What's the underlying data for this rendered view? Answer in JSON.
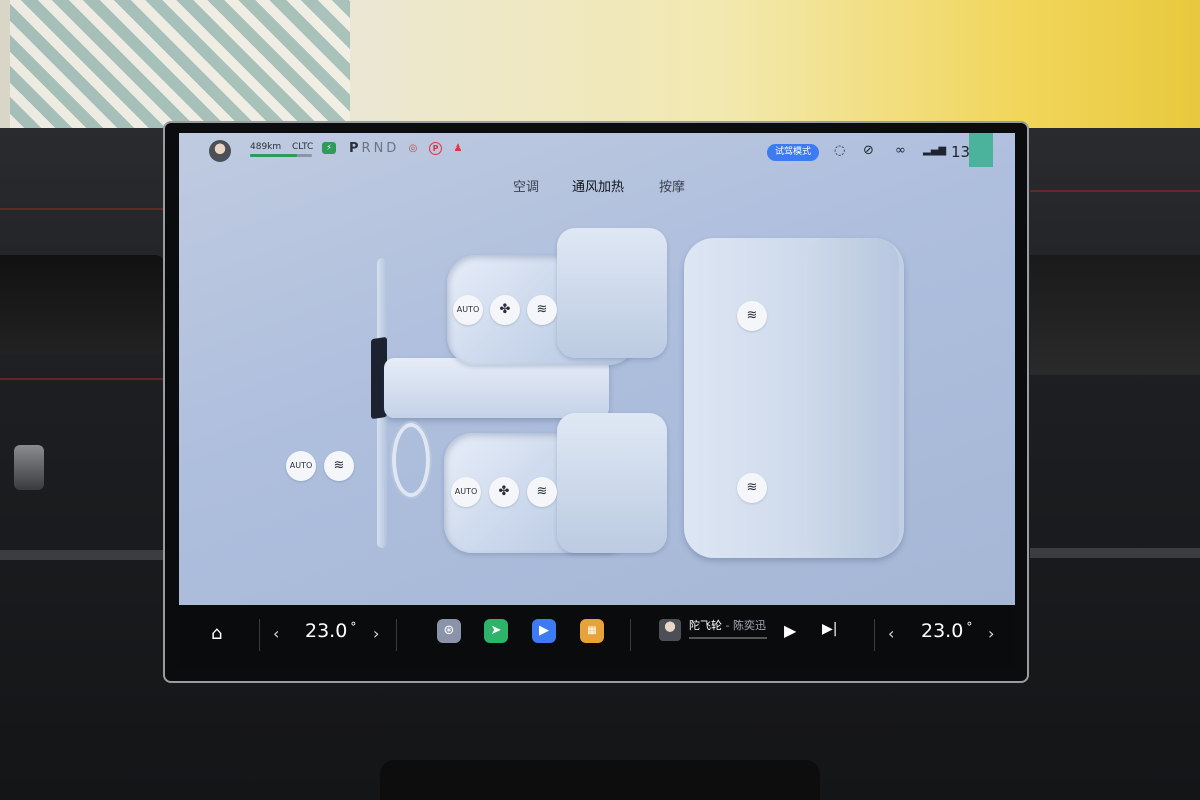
{
  "status": {
    "range": "489km",
    "range_fraction": 0.75,
    "cycle": "CLTC",
    "gear": "PRND",
    "gear_selected": "P",
    "mode_badge": "试驾模式",
    "clock": "13",
    "accent_color": "#3d7bf2",
    "warning_color": "#e0353d"
  },
  "tabs": [
    {
      "label": "空调",
      "active": false
    },
    {
      "label": "通风加热",
      "active": true
    },
    {
      "label": "按摩",
      "active": false
    }
  ],
  "seat_controls": {
    "auto_label": "AUTO",
    "front_left": [
      "AUTO",
      "fan-icon",
      "heat-icon"
    ],
    "front_right": [
      "AUTO",
      "fan-icon",
      "heat-icon"
    ],
    "steering": [
      "AUTO",
      "heat-icon"
    ],
    "rear_left": [
      "heat-icon"
    ],
    "rear_right": [
      "heat-icon"
    ]
  },
  "bottom_bar": {
    "left_temp": "23.0",
    "right_temp": "23.0",
    "degree": "°",
    "apps": [
      "steering-app-icon",
      "maps-app-icon",
      "video-call-app-icon",
      "app-grid-icon"
    ],
    "song_title": "陀飞轮",
    "song_sep": " - ",
    "song_artist": "陈奕迅"
  }
}
